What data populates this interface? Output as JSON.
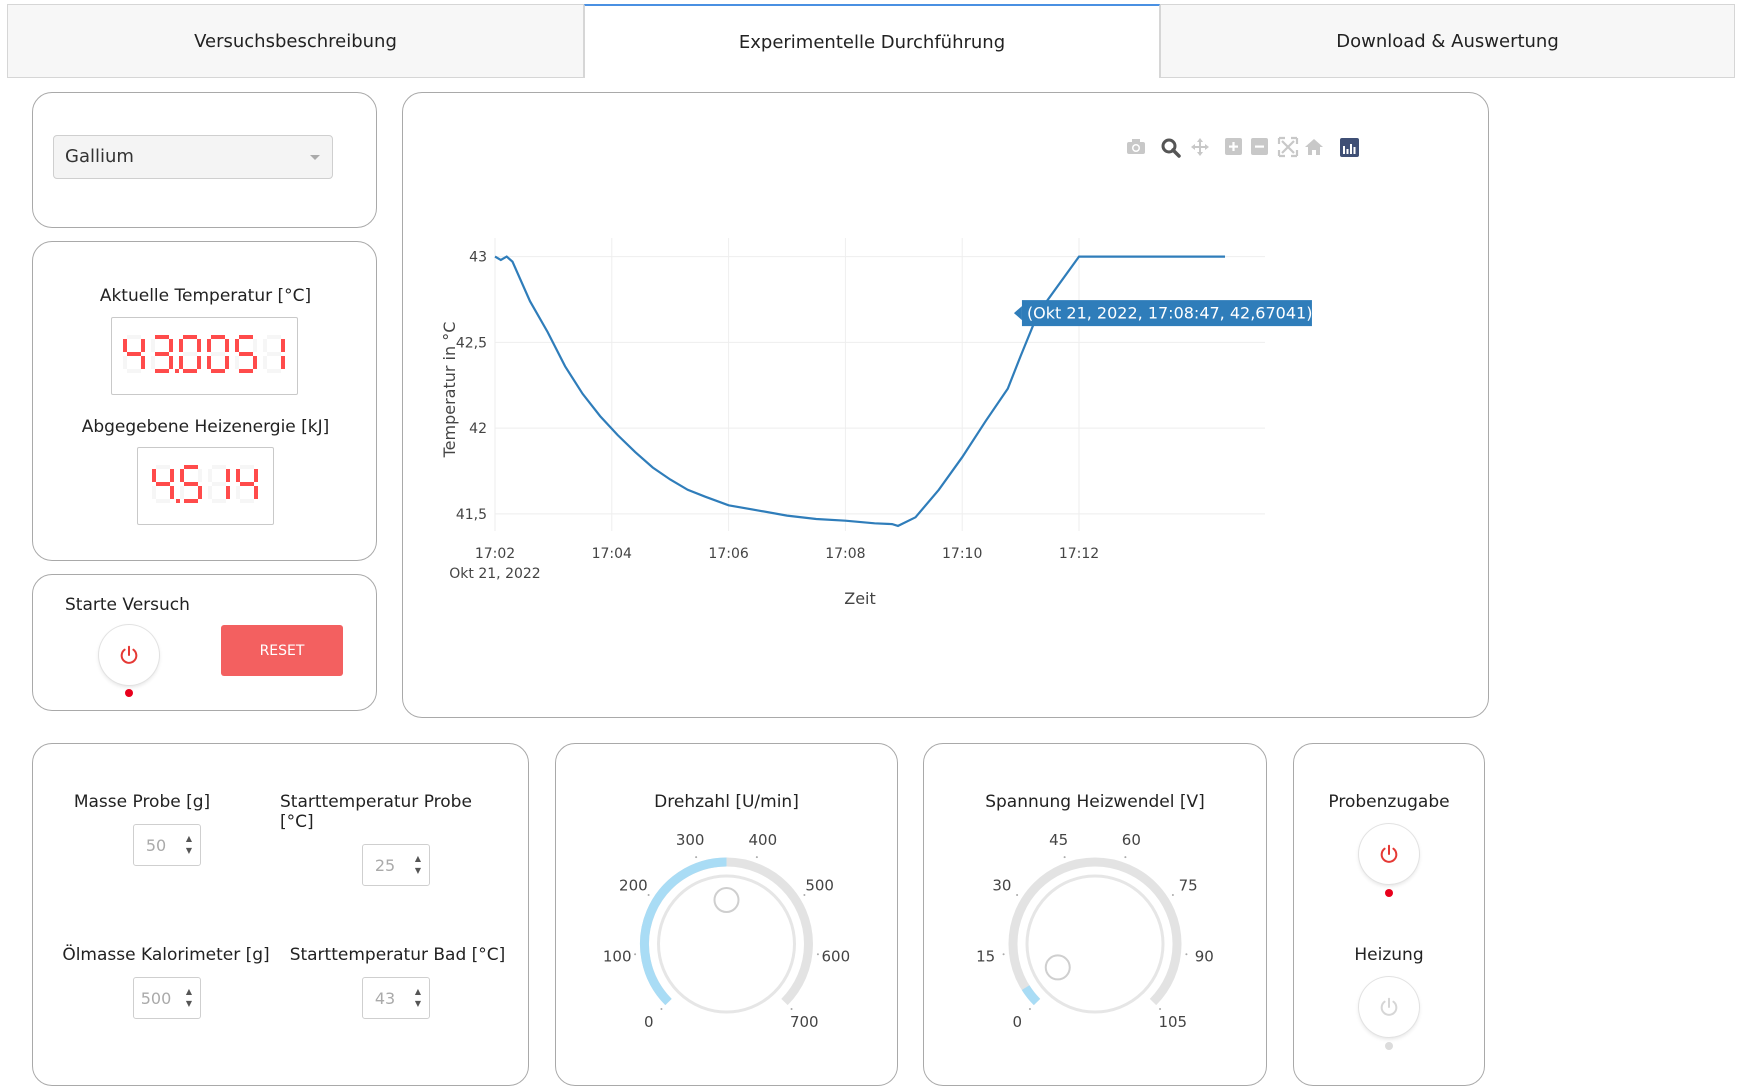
{
  "tabs": [
    {
      "label": "Versuchsbeschreibung",
      "active": false
    },
    {
      "label": "Experimentelle Durchführung",
      "active": true
    },
    {
      "label": "Download & Auswertung",
      "active": false
    }
  ],
  "material_select": {
    "value": "Gallium"
  },
  "readouts": {
    "temp_label": "Aktuelle Temperatur [°C]",
    "temp_value": "43.0051",
    "energy_label": "Abgegebene Heizenergie [kJ]",
    "energy_value": "4.514",
    "lcd_color": "#ff4b4b"
  },
  "start": {
    "label": "Starte Versuch",
    "reset_label": "RESET",
    "led_color": "#e8001c"
  },
  "chart": {
    "modebar": [
      "camera-icon",
      "zoom-icon",
      "pan-icon",
      "zoom-in-icon",
      "zoom-out-icon",
      "autoscale-icon",
      "reset-axes-icon",
      "plotly-logo-icon"
    ],
    "tooltip": "(Okt 21, 2022, 17:08:47, 42,67041)"
  },
  "chart_data": {
    "type": "line",
    "title": "",
    "xlabel": "Zeit",
    "ylabel": "Temperatur in °C",
    "x_ticks": [
      "17:02",
      "17:04",
      "17:06",
      "17:08",
      "17:10",
      "17:12"
    ],
    "x_date_label": "Okt 21, 2022",
    "y_ticks": [
      "41,5",
      "42",
      "42,5",
      "43"
    ],
    "x_range": [
      "17:02",
      "17:12:30"
    ],
    "y_range": [
      41.4,
      43.05
    ],
    "grid": true,
    "line_color": "#2f7dba",
    "series": [
      {
        "x": [
          0.0,
          0.1,
          0.2,
          0.3,
          0.6,
          0.9,
          1.2,
          1.5,
          1.8,
          2.1,
          2.4,
          2.7,
          3.0,
          3.3,
          3.6,
          4.0,
          4.5,
          5.0,
          5.5,
          6.0,
          6.5,
          6.8,
          6.9,
          7.2,
          7.6,
          8.0,
          8.4,
          8.78,
          9.0,
          9.3,
          10.0,
          11.0,
          12.0,
          12.5
        ],
        "y": [
          43.0,
          42.98,
          43.0,
          42.97,
          42.74,
          42.56,
          42.36,
          42.2,
          42.07,
          41.96,
          41.86,
          41.77,
          41.7,
          41.64,
          41.6,
          41.55,
          41.52,
          41.49,
          41.47,
          41.46,
          41.445,
          41.44,
          41.43,
          41.48,
          41.64,
          41.83,
          42.04,
          42.23,
          42.42,
          42.67,
          43.0,
          43.0,
          43.0,
          43.0
        ]
      }
    ]
  },
  "params": {
    "mass_label": "Masse Probe [g]",
    "mass_value": "50",
    "start_temp_label": "Starttemperatur Probe [°C]",
    "start_temp_value": "25",
    "oil_label": "Ölmasse Kalorimeter [g]",
    "oil_value": "500",
    "bath_label": "Starttemperatur Bad [°C]",
    "bath_value": "43"
  },
  "rpm_knob": {
    "label": "Drehzahl [U/min]",
    "ticks": [
      "0",
      "100",
      "200",
      "300",
      "400",
      "500",
      "600",
      "700"
    ],
    "min": 0,
    "max": 700,
    "value": 350,
    "fill_color": "#a9dcf5",
    "track_color": "#e3e3e3"
  },
  "voltage_knob": {
    "label": "Spannung Heizwendel [V]",
    "ticks": [
      "0",
      "15",
      "30",
      "45",
      "60",
      "75",
      "90",
      "105"
    ],
    "min": 0,
    "max": 105,
    "value": 5,
    "fill_color": "#a9dcf5",
    "track_color": "#e3e3e3"
  },
  "toggles": {
    "sample_label": "Probenzugabe",
    "sample_on": true,
    "heating_label": "Heizung",
    "heating_on": false
  }
}
